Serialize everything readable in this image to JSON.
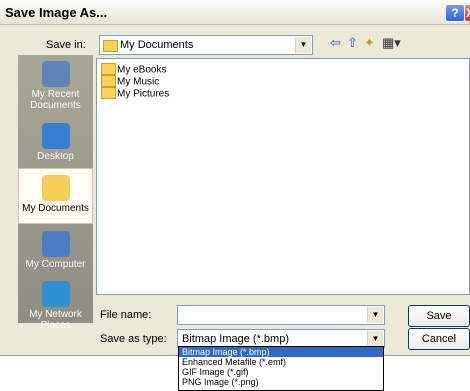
{
  "dialog": {
    "title": "Save Image As...",
    "help_glyph": "?",
    "close_glyph": "X"
  },
  "save_in": {
    "label": "Save in:",
    "value": "My Documents"
  },
  "places": [
    {
      "label": "My Recent Documents",
      "icon": "recent-documents-icon"
    },
    {
      "label": "Desktop",
      "icon": "desktop-icon"
    },
    {
      "label": "My Documents",
      "icon": "my-documents-icon",
      "selected": true
    },
    {
      "label": "My Computer",
      "icon": "my-computer-icon"
    },
    {
      "label": "My Network Places",
      "icon": "network-places-icon"
    }
  ],
  "files": [
    {
      "name": "My eBooks",
      "icon": "folder-icon"
    },
    {
      "name": "My Music",
      "icon": "music-folder-icon"
    },
    {
      "name": "My Pictures",
      "icon": "pictures-folder-icon"
    }
  ],
  "file_name": {
    "label": "File name:",
    "value": ""
  },
  "save_as_type": {
    "label": "Save as type:",
    "value": "Bitmap Image (*.bmp)"
  },
  "type_options": [
    "Bitmap Image (*.bmp)",
    "Enhanced Metafile (*.emf)",
    "GIF Image (*.gif)",
    "PNG Image (*.png)"
  ],
  "buttons": {
    "save": "Save",
    "cancel": "Cancel"
  },
  "colors": {
    "selection": "#316ac5",
    "places_bg": "#9c9a8f",
    "dialog_bg": "#ece9d8"
  }
}
